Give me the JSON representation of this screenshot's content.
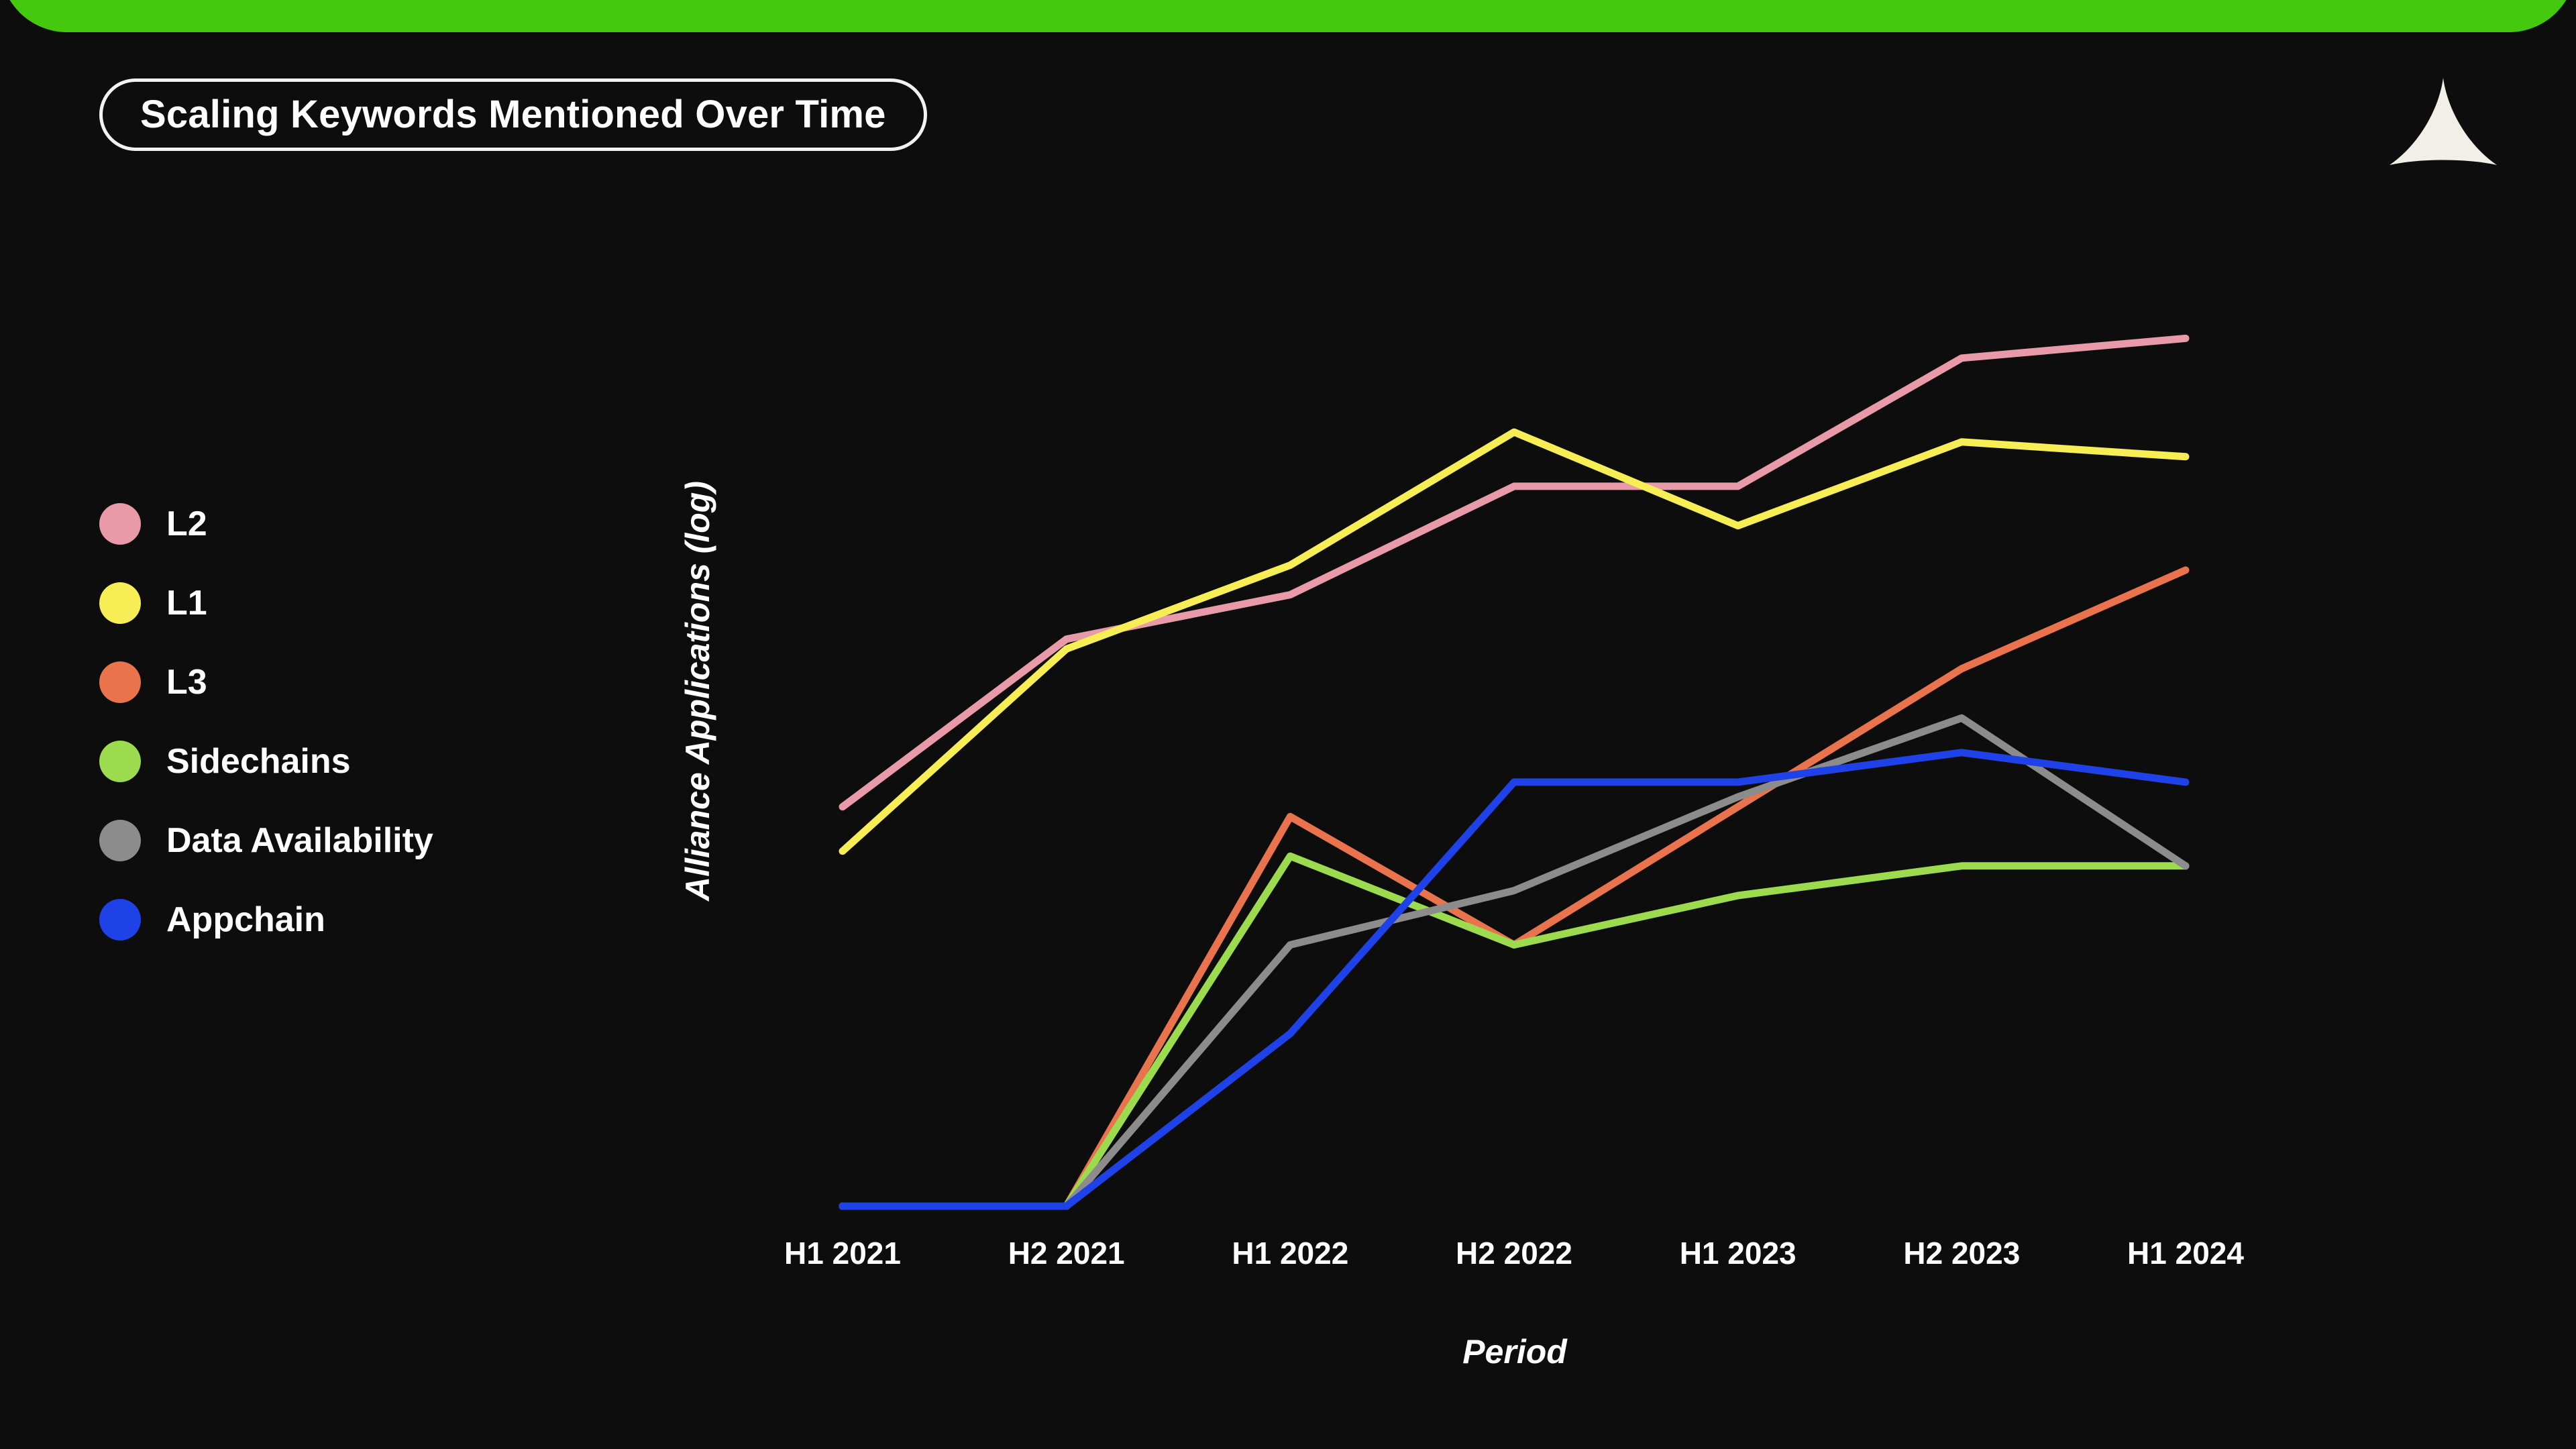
{
  "header": {
    "accent_color": "#45c90f",
    "title": "Scaling Keywords Mentioned Over Time",
    "logo_icon": "alliance-triangle-logo"
  },
  "background_color": "#0d0d0d",
  "legend": {
    "position": "left",
    "items": [
      {
        "label": "L2",
        "color": "#e89aa8"
      },
      {
        "label": "L1",
        "color": "#f7ee55"
      },
      {
        "label": "L3",
        "color": "#e8734d"
      },
      {
        "label": "Sidechains",
        "color": "#9bdb4d"
      },
      {
        "label": "Data Availability",
        "color": "#8c8c8c"
      },
      {
        "label": "Appchain",
        "color": "#1f42e8"
      }
    ]
  },
  "chart_data": {
    "type": "line",
    "title": "Scaling Keywords Mentioned Over Time",
    "xlabel": "Period",
    "ylabel": "Alliance Applications (log)",
    "grid": false,
    "legend_position": "left",
    "categories": [
      "H1 2021",
      "H2 2021",
      "H1 2022",
      "H2 2022",
      "H1 2023",
      "H2 2023",
      "H1 2024"
    ],
    "ylim": [
      0,
      10
    ],
    "yscale": "log",
    "series": [
      {
        "name": "L2",
        "color": "#e89aa8",
        "values": [
          4.05,
          5.75,
          6.2,
          7.3,
          7.3,
          8.6,
          8.8
        ]
      },
      {
        "name": "L1",
        "color": "#f7ee55",
        "values": [
          3.6,
          5.65,
          6.5,
          7.85,
          6.9,
          7.75,
          7.6
        ]
      },
      {
        "name": "L3",
        "color": "#e8734d",
        "values": [
          0,
          0,
          3.95,
          2.65,
          4.05,
          5.45,
          6.45
        ]
      },
      {
        "name": "Sidechains",
        "color": "#9bdb4d",
        "values": [
          0,
          0,
          3.55,
          2.65,
          3.15,
          3.45,
          3.45
        ]
      },
      {
        "name": "Data Availability",
        "color": "#8c8c8c",
        "values": [
          0,
          0,
          2.65,
          3.2,
          4.15,
          4.95,
          3.45
        ]
      },
      {
        "name": "Appchain",
        "color": "#1f42e8",
        "values": [
          0,
          0,
          1.75,
          4.3,
          4.3,
          4.6,
          4.3
        ]
      }
    ]
  },
  "axis": {
    "x_ticks": [
      "H1 2021",
      "H2 2021",
      "H1 2022",
      "H2 2022",
      "H1 2023",
      "H2 2023",
      "H1 2024"
    ],
    "x_title": "Period",
    "y_title": "Alliance Applications (log)"
  }
}
